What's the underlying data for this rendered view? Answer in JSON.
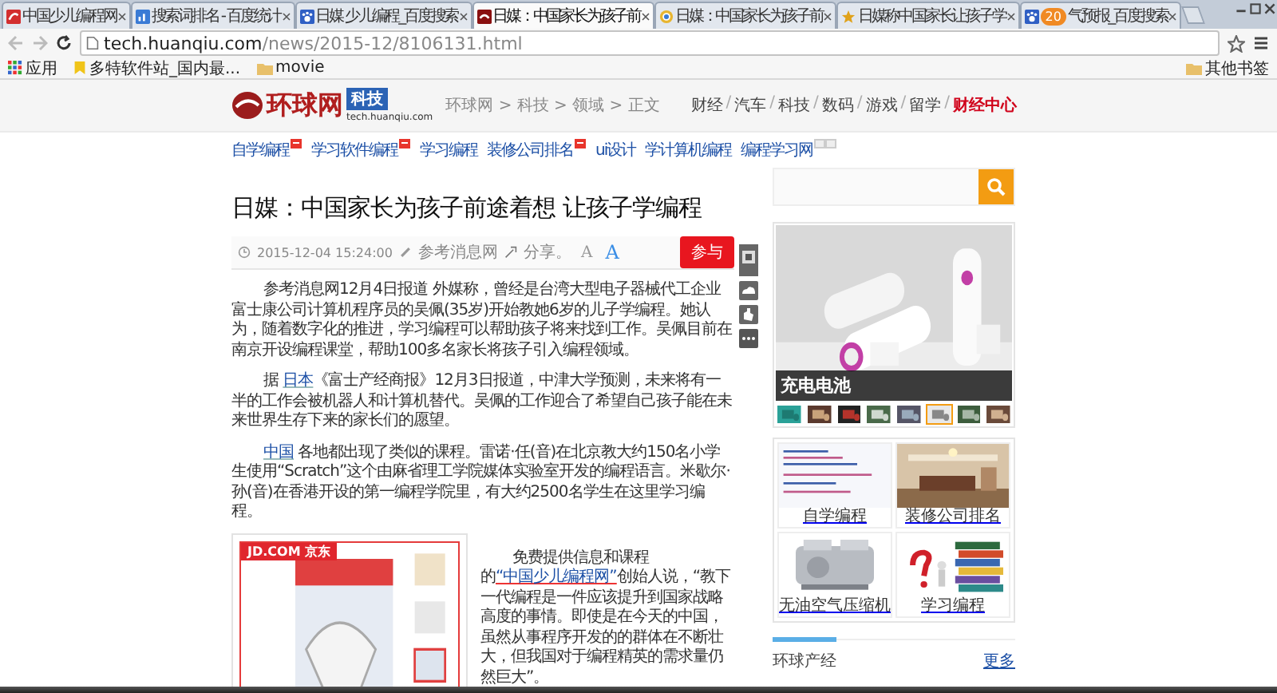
{
  "browser": {
    "tabs": [
      {
        "title": "中国少儿编程网",
        "kind": "red",
        "selected": false
      },
      {
        "title": "搜索词排名 - 百度统计",
        "kind": "chart",
        "selected": false
      },
      {
        "title": "日媒 少儿编程_百度搜索",
        "kind": "paw",
        "selected": false
      },
      {
        "title": "日媒：中国家长为孩子前",
        "kind": "dark",
        "selected": true
      },
      {
        "title": "日媒：中国家长为孩子前",
        "kind": "globe",
        "selected": false
      },
      {
        "title": "日媒称中国家长让孩子学",
        "kind": "star",
        "selected": false
      },
      {
        "title": "气预报_百度搜索",
        "kind": "paw",
        "badge": "20",
        "selected": false
      }
    ],
    "url": {
      "host": "tech.huanqiu.com",
      "path": "/news/2015-12/8106131.html"
    },
    "bookmarks": [
      {
        "label": "应用",
        "kind": "apps"
      },
      {
        "label": "多特软件站_国内最...",
        "kind": "page"
      },
      {
        "label": "movie",
        "kind": "folder"
      }
    ],
    "other_bookmarks": "其他书签"
  },
  "header": {
    "logo": "环球网",
    "logo_badge": "科技",
    "logo_domain": "tech.huanqiu.com",
    "breadcrumb": "环球网 > 科技 > 领域 > 正文",
    "channel_separator": "/",
    "channels": [
      {
        "label": "财经",
        "highlight": false
      },
      {
        "label": "汽车",
        "highlight": false
      },
      {
        "label": "科技",
        "highlight": false
      },
      {
        "label": "数码",
        "highlight": false
      },
      {
        "label": "游戏",
        "highlight": false
      },
      {
        "label": "留学",
        "highlight": false
      },
      {
        "label": "财经中心",
        "highlight": true
      }
    ]
  },
  "links": [
    {
      "label": "自学编程",
      "kind": "new"
    },
    {
      "label": "学习软件编程",
      "kind": "new"
    },
    {
      "label": "学习编程",
      "kind": "plain"
    },
    {
      "label": "装修公司排名",
      "kind": "new"
    },
    {
      "label": "ui设计",
      "kind": "plain"
    },
    {
      "label": "学计算机编程",
      "kind": "plain"
    },
    {
      "label": "编程学习网",
      "kind": "ad"
    }
  ],
  "article": {
    "title": "日媒：中国家长为孩子前途着想 让孩子学编程",
    "time": "2015-12-04 15:24:00",
    "source": "参考消息网",
    "share": "分享。",
    "font_buttons": [
      {
        "label": "A",
        "kind": "smaller"
      },
      {
        "label": "A",
        "kind": "larger"
      }
    ],
    "comment": "参与",
    "paragraphs": [
      [
        {
          "text": "参考消息网12月4日报道 外媒称，曾经是台湾大型电子器械代工企业富士康公司计算机程序员的吴佩(35岁)开始教她6岁的儿子学编程。她认为，随着数字化的推进，学习编程可以帮助孩子将来找到工作。吴佩目前在南京开设编程课堂，帮助100多名家长将孩子引入编程领域。",
          "link": false
        }
      ],
      [
        {
          "text": "据 ",
          "link": false
        },
        {
          "text": "日本",
          "link": true
        },
        {
          "text": "《富士产经商报》12月3日报道，中津大学预测，未来将有一半的工作会被机器人和计算机替代。吴佩的工作迎合了希望自己孩子能在未来世界生存下来的家长们的愿望。",
          "link": false
        }
      ],
      [
        {
          "text": "中国",
          "link": true
        },
        {
          "text": " 各地都出现了类似的课程。雷诺·任(音)在北京教大约150名小学生使用“Scratch”这个由麻省理工学院媒体实验室开发的编程语言。米歇尔·孙(音)在香港开设的第一编程学院里，有大约2500名学生在这里学习编程。",
          "link": false
        }
      ]
    ],
    "ad_label": "JD.COM 京东",
    "aside": [
      {
        "text": "免费提供信息和课程的",
        "link": false
      },
      {
        "text": "“中国少儿编程网”",
        "link": true
      },
      {
        "text": "创始人说，“教下一代编程是一件应该提升到国家战略高度的事情。即使是在今天的中国，虽然从事程序开发的的群体在不断壮大，但我国对于编程精英的需求量仍然巨大”。",
        "link": false
      }
    ]
  },
  "sidebar": {
    "slideshow": {
      "caption": "充电电池",
      "thumbs": [
        {
          "selected": false
        },
        {
          "selected": false
        },
        {
          "selected": false
        },
        {
          "selected": false
        },
        {
          "selected": false
        },
        {
          "selected": true
        },
        {
          "selected": false
        },
        {
          "selected": false
        }
      ]
    },
    "grid": [
      {
        "caption": "自学编程"
      },
      {
        "caption": "装修公司排名"
      },
      {
        "caption": "无油空气压缩机"
      },
      {
        "caption": "学习编程"
      }
    ],
    "section": {
      "title": "环球产经",
      "more": "更多"
    }
  }
}
